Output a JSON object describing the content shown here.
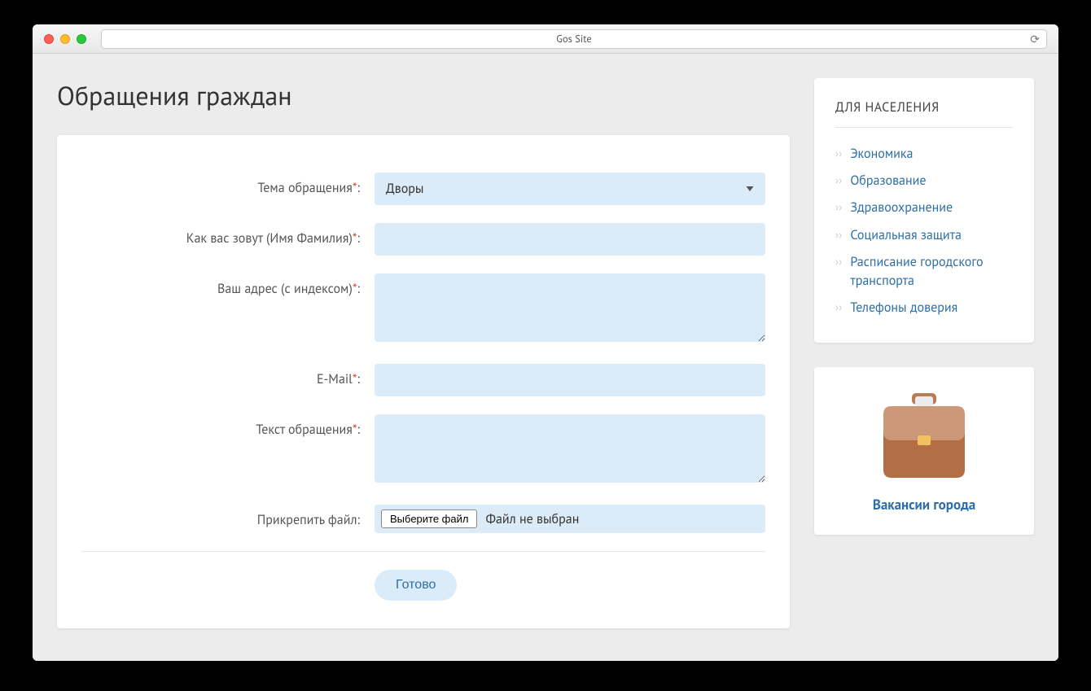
{
  "browser": {
    "title": "Gos Site"
  },
  "page": {
    "title": "Обращения граждан"
  },
  "form": {
    "fields": {
      "topic": {
        "label": "Тема обращения",
        "value": "Дворы"
      },
      "name": {
        "label": "Как вас зовут (Имя Фамилия)",
        "value": ""
      },
      "address": {
        "label": "Ваш адрес (с индексом)",
        "value": ""
      },
      "email": {
        "label": "E-Mail",
        "value": ""
      },
      "message": {
        "label": "Текст обращения",
        "value": ""
      },
      "file": {
        "label": "Прикрепить файл:",
        "button": "Выберите файл",
        "status": "Файл не выбран"
      }
    },
    "required_mark": "*",
    "colon": ":",
    "submit": "Готово"
  },
  "sidebar": {
    "population": {
      "title": "ДЛЯ НАСЕЛЕНИЯ",
      "items": [
        "Экономика",
        "Образование",
        "Здравоохранение",
        "Социальная защита",
        "Расписание городского транспорта",
        "Телефоны доверия"
      ]
    },
    "promo": {
      "label": "Вакансии города"
    }
  }
}
